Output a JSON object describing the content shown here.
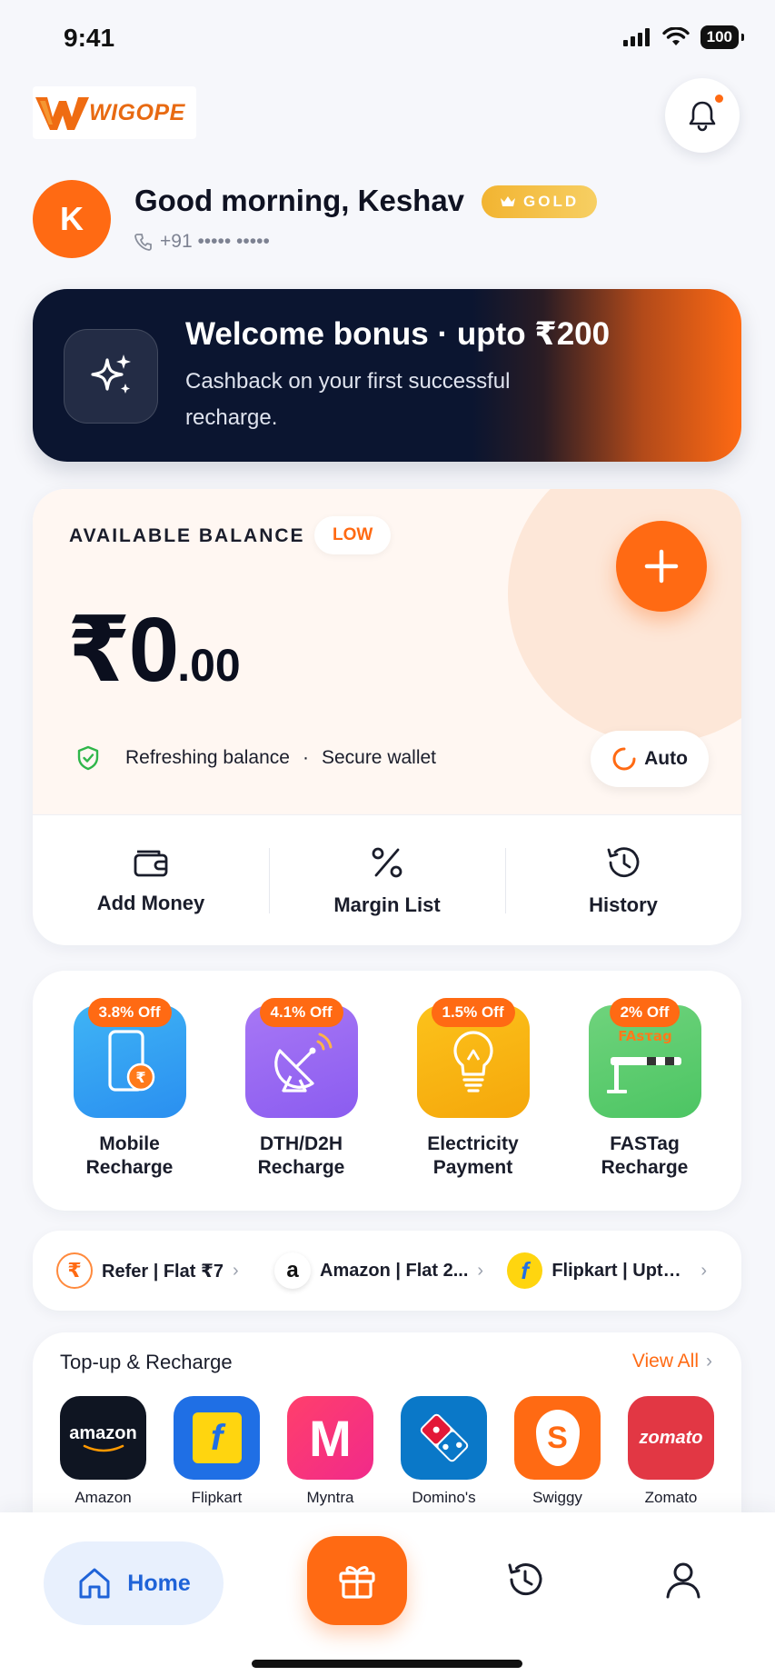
{
  "status_bar": {
    "time": "9:41",
    "battery": "100"
  },
  "header": {
    "logo_text": "WIGOPE"
  },
  "greeting": {
    "avatar_initial": "K",
    "title": "Good morning, Keshav",
    "tier": "GOLD",
    "phone": "+91 ••••• •••••"
  },
  "banner": {
    "title": "Welcome bonus · upto ₹200",
    "subtitle": "Cashback on your first successful recharge."
  },
  "balance": {
    "label": "AVAILABLE BALANCE",
    "badge": "LOW",
    "amount_int": "₹0",
    "amount_dec": ".00",
    "status_refresh": "Refreshing balance",
    "status_sep": "·",
    "status_secure": "Secure wallet",
    "auto_label": "Auto"
  },
  "quick_actions": [
    {
      "label": "Add Money",
      "icon": "wallet-icon"
    },
    {
      "label": "Margin List",
      "icon": "percent-icon"
    },
    {
      "label": "History",
      "icon": "history-icon"
    }
  ],
  "services": [
    {
      "discount": "3.8% Off",
      "line1": "Mobile",
      "line2": "Recharge",
      "icon": "mobile-recharge-icon",
      "color_from": "#3fb4f5",
      "color_to": "#2a8ff0"
    },
    {
      "discount": "4.1% Off",
      "line1": "DTH/D2H",
      "line2": "Recharge",
      "icon": "satellite-dish-icon",
      "color_from": "#a777f5",
      "color_to": "#8b5cf0"
    },
    {
      "discount": "1.5% Off",
      "line1": "Electricity",
      "line2": "Payment",
      "icon": "bulb-icon",
      "color_from": "#fcc21b",
      "color_to": "#f5a70b"
    },
    {
      "discount": "2% Off",
      "line1": "FASTag",
      "line2": "Recharge",
      "icon": "toll-barrier-icon",
      "tag": "FAsτag",
      "color_from": "#6fd37c",
      "color_to": "#4cc563"
    }
  ],
  "offers": [
    {
      "text": "Refer | Flat ₹7",
      "icon": "rupee-icon"
    },
    {
      "text": "Amazon | Flat 2...",
      "icon": "amazon-logo-icon"
    },
    {
      "text": "Flipkart | Upto ...",
      "icon": "flipkart-logo-icon"
    }
  ],
  "topup": {
    "title": "Top-up & Recharge",
    "view_all": "View All",
    "brands": [
      {
        "name": "Amazon",
        "logo_text": "amazon",
        "bg": "#0f1522"
      },
      {
        "name": "Flipkart",
        "logo_text": "f",
        "bg": "#1f6fe5"
      },
      {
        "name": "Myntra",
        "logo_text": "M",
        "bg": "#ff2e7e"
      },
      {
        "name": "Domino's",
        "logo_text": "",
        "bg": "#0a78c8"
      },
      {
        "name": "Swiggy",
        "logo_text": "S",
        "bg": "#ff6a13"
      },
      {
        "name": "Zomato",
        "logo_text": "zomato",
        "bg": "#e23744"
      }
    ]
  },
  "bottom_nav": {
    "home_label": "Home"
  },
  "colors": {
    "accent": "#ff6a13",
    "banner_dark": "#0b1530",
    "home_blue": "#1f63d8",
    "gold": "#f2b431"
  }
}
